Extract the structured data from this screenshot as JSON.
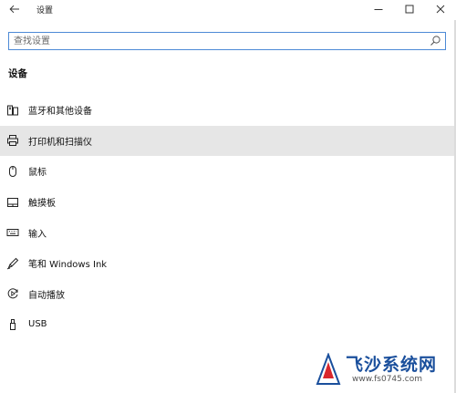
{
  "window": {
    "title": "设置",
    "back_icon": "back-arrow-icon",
    "minimize_icon": "minimize-icon",
    "maximize_icon": "maximize-icon",
    "close_icon": "close-icon"
  },
  "search": {
    "placeholder": "查找设置",
    "icon": "search-icon"
  },
  "section": {
    "title": "设备"
  },
  "nav": {
    "items": [
      {
        "label": "蓝牙和其他设备",
        "icon": "bluetooth-devices-icon",
        "selected": false
      },
      {
        "label": "打印机和扫描仪",
        "icon": "printer-icon",
        "selected": true
      },
      {
        "label": "鼠标",
        "icon": "mouse-icon",
        "selected": false
      },
      {
        "label": "触摸板",
        "icon": "touchpad-icon",
        "selected": false
      },
      {
        "label": "输入",
        "icon": "keyboard-icon",
        "selected": false
      },
      {
        "label": "笔和 Windows Ink",
        "icon": "pen-icon",
        "selected": false
      },
      {
        "label": "自动播放",
        "icon": "autoplay-icon",
        "selected": false
      },
      {
        "label": "USB",
        "icon": "usb-icon",
        "selected": false
      }
    ]
  },
  "watermark": {
    "brand": "飞沙系统网",
    "url": "www.fs0745.com"
  },
  "colors": {
    "accent": "#4d8ad6",
    "selected_bg": "#e6e6e6",
    "watermark_blue": "#1a4f9c",
    "watermark_red": "#d9262c"
  }
}
